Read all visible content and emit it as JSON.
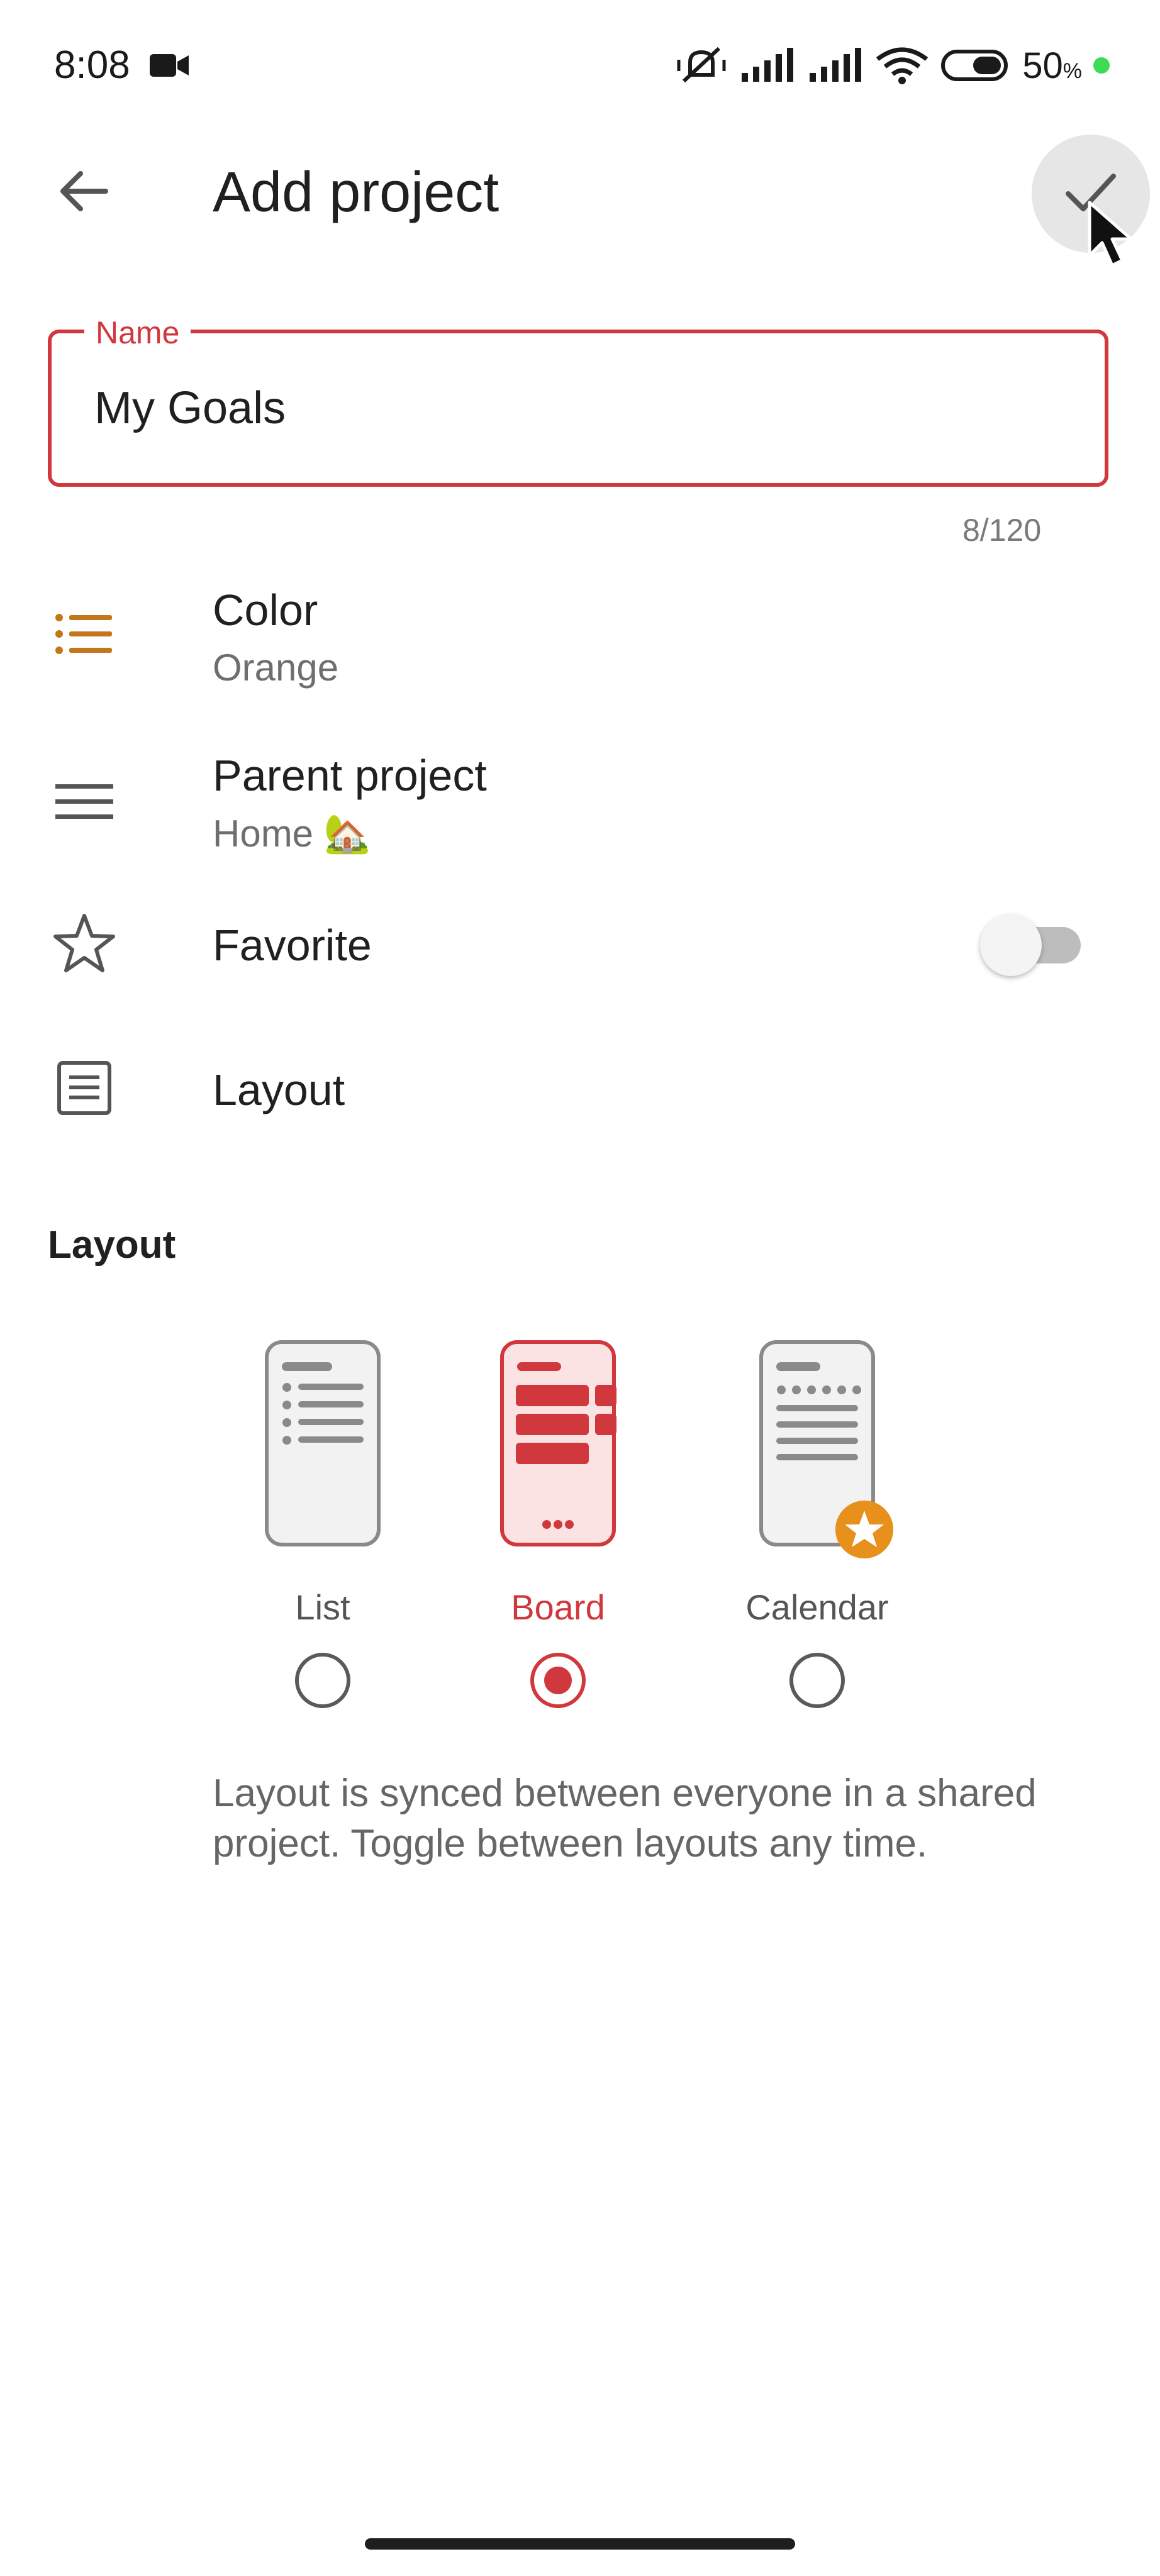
{
  "status_bar": {
    "time": "8:08",
    "battery": "50",
    "battery_unit": "%"
  },
  "toolbar": {
    "title": "Add project",
    "back_icon": "arrow-left-icon",
    "confirm_icon": "check-icon"
  },
  "name_field": {
    "label": "Name",
    "value": "My Goals",
    "counter": "8/120"
  },
  "settings": {
    "color": {
      "title": "Color",
      "value": "Orange",
      "accent": "#c4761a"
    },
    "parent": {
      "title": "Parent project",
      "value": "Home 🏡"
    },
    "favorite": {
      "title": "Favorite",
      "enabled": false
    },
    "layout": {
      "title": "Layout"
    }
  },
  "layout_section": {
    "heading": "Layout",
    "options": [
      {
        "label": "List",
        "selected": false
      },
      {
        "label": "Board",
        "selected": true
      },
      {
        "label": "Calendar",
        "selected": false,
        "badge": "star-icon"
      }
    ],
    "info": "Layout is synced between everyone in a shared project. Toggle between layouts any time."
  },
  "colors": {
    "accent": "#d1383e",
    "badge": "#e8901c"
  }
}
